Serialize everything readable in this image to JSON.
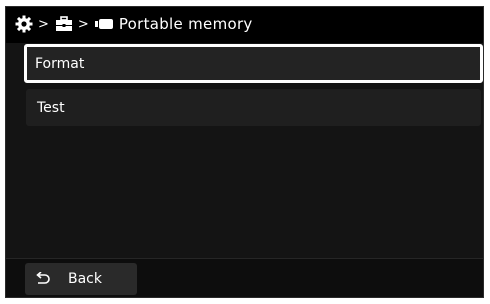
{
  "breadcrumb": {
    "icons": [
      "gear-icon",
      "toolbox-icon",
      "memory-card-icon"
    ],
    "separator": ">",
    "title": "Portable memory"
  },
  "menu": {
    "items": [
      {
        "label": "Format",
        "selected": true
      },
      {
        "label": "Test",
        "selected": false
      }
    ]
  },
  "footer": {
    "back_label": "Back",
    "back_icon": "return-arrow-icon"
  },
  "colors": {
    "background": "#141414",
    "header": "#000000",
    "item": "#1f1f1f",
    "selection_outline": "#ffffff",
    "text": "#ffffff"
  }
}
